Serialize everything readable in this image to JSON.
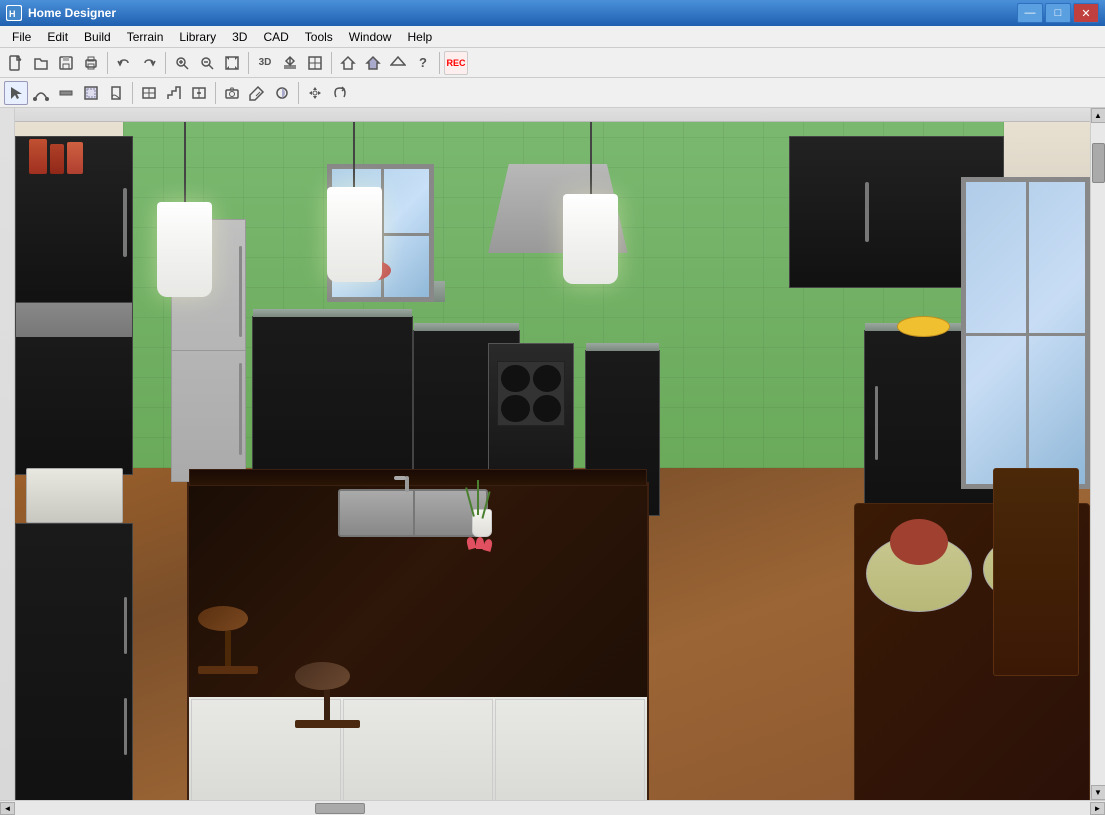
{
  "titleBar": {
    "title": "Home Designer",
    "icon": "HD",
    "buttons": {
      "minimize": "—",
      "maximize": "□",
      "close": "✕"
    }
  },
  "menuBar": {
    "items": [
      {
        "id": "file",
        "label": "File"
      },
      {
        "id": "edit",
        "label": "Edit"
      },
      {
        "id": "build",
        "label": "Build"
      },
      {
        "id": "terrain",
        "label": "Terrain"
      },
      {
        "id": "library",
        "label": "Library"
      },
      {
        "id": "3d",
        "label": "3D"
      },
      {
        "id": "cad",
        "label": "CAD"
      },
      {
        "id": "tools",
        "label": "Tools"
      },
      {
        "id": "window",
        "label": "Window"
      },
      {
        "id": "help",
        "label": "Help"
      }
    ]
  },
  "toolbar1": {
    "buttons": [
      {
        "id": "new",
        "icon": "📄",
        "label": "New"
      },
      {
        "id": "open",
        "icon": "📂",
        "label": "Open"
      },
      {
        "id": "save",
        "icon": "💾",
        "label": "Save"
      },
      {
        "id": "print",
        "icon": "🖨",
        "label": "Print"
      },
      {
        "id": "undo",
        "icon": "↩",
        "label": "Undo"
      },
      {
        "id": "redo",
        "icon": "↪",
        "label": "Redo"
      },
      {
        "id": "zoom-in",
        "icon": "🔍+",
        "label": "Zoom In"
      },
      {
        "id": "zoom-out",
        "icon": "🔍-",
        "label": "Zoom Out"
      },
      {
        "id": "fit",
        "icon": "⊡",
        "label": "Fit"
      },
      {
        "id": "help",
        "icon": "?",
        "label": "Help"
      }
    ]
  },
  "toolbar2": {
    "buttons": [
      {
        "id": "select",
        "icon": "↖",
        "label": "Select"
      },
      {
        "id": "arc",
        "icon": "⌒",
        "label": "Arc"
      },
      {
        "id": "wall",
        "icon": "┤",
        "label": "Wall"
      },
      {
        "id": "room",
        "icon": "▦",
        "label": "Room"
      },
      {
        "id": "door",
        "icon": "🚪",
        "label": "Door"
      },
      {
        "id": "window",
        "icon": "⬜",
        "label": "Window"
      },
      {
        "id": "stairs",
        "icon": "▤",
        "label": "Stairs"
      },
      {
        "id": "camera",
        "icon": "📷",
        "label": "Camera"
      },
      {
        "id": "paint",
        "icon": "🖌",
        "label": "Paint"
      },
      {
        "id": "material",
        "icon": "◈",
        "label": "Material"
      }
    ]
  },
  "viewport": {
    "type": "3D Kitchen View",
    "description": "3D rendered view of a modern kitchen with dark cabinets, granite countertops, pendant lights, hardwood floors, green tile backsplash, kitchen island with sink"
  },
  "statusBar": {
    "scrollH": true,
    "scrollV": true
  }
}
